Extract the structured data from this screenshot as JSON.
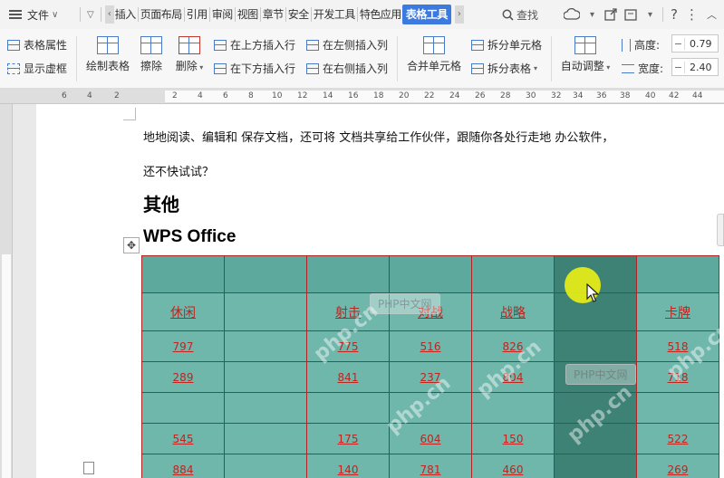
{
  "menubar": {
    "file_label": "文件",
    "items": [
      "插入",
      "页面布局",
      "引用",
      "审阅",
      "视图",
      "章节",
      "安全",
      "开发工具",
      "特色应用"
    ],
    "active_tab": "表格工具",
    "search_label": "查找"
  },
  "ribbon": {
    "table_props": "表格属性",
    "show_gridlines": "显示虚框",
    "draw_table": "绘制表格",
    "erase": "擦除",
    "delete": "删除",
    "insert_row_above": "在上方插入行",
    "insert_row_below": "在下方插入行",
    "insert_col_left": "在左侧插入列",
    "insert_col_right": "在右侧插入列",
    "merge_cells": "合并单元格",
    "split_cells": "拆分单元格",
    "split_table": "拆分表格",
    "auto_fit": "自动调整",
    "height_label": "高度:",
    "height_value": "0.79",
    "width_label": "宽度:",
    "width_value": "2.40",
    "minus": "−"
  },
  "ruler": {
    "labels": [
      "6",
      "4",
      "2",
      "2",
      "4",
      "6",
      "8",
      "10",
      "12",
      "14",
      "16",
      "18",
      "20",
      "22",
      "24",
      "26",
      "28",
      "30",
      "32",
      "34",
      "36",
      "38",
      "40",
      "42",
      "44"
    ]
  },
  "document": {
    "paragraph1": "地地阅读、编辑和  保存文档，还可将  文档共享给工作伙伴，跟随你各处行走地  办公软件，",
    "paragraph2": "还不快试试？",
    "heading1": "其他",
    "heading2": "WPS Office",
    "move_handle": "✥"
  },
  "table": {
    "rows": [
      [
        "",
        "",
        "",
        "",
        "",
        "",
        ""
      ],
      [
        "休闲",
        "",
        "射击",
        "对战",
        "战略",
        "",
        "卡牌"
      ],
      [
        "797",
        "",
        "775",
        "516",
        "826",
        "",
        "518"
      ],
      [
        "289",
        "",
        "841",
        "237",
        "804",
        "",
        "718"
      ],
      [
        "",
        "",
        "",
        "",
        "",
        "",
        ""
      ],
      [
        "545",
        "",
        "175",
        "604",
        "150",
        "",
        "522"
      ],
      [
        "884",
        "",
        "140",
        "781",
        "460",
        "",
        "269"
      ]
    ],
    "selected_col": 5
  },
  "watermarks": [
    "php.cn",
    "PHP中文网"
  ],
  "colors": {
    "accent": "#3d7ae0",
    "cell_fill": "#6fb6ab",
    "selected_col": "#3e8276",
    "border": "#b12424",
    "cell_text": "#c0241f"
  }
}
